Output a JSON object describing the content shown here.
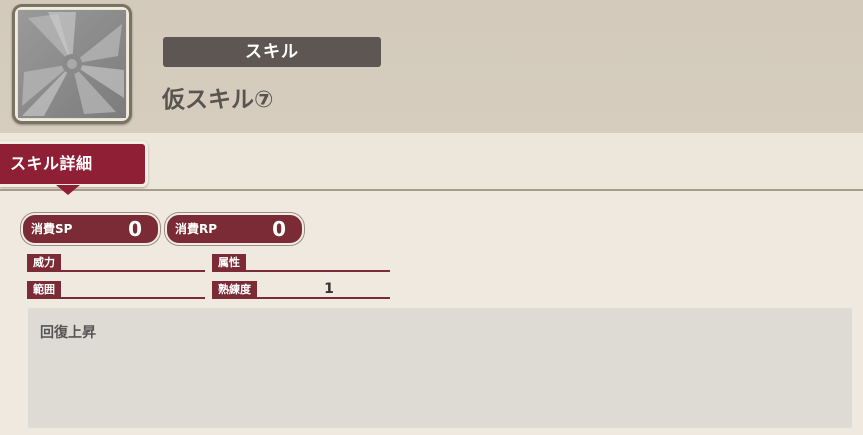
{
  "header": {
    "icon": "skill-placeholder-icon",
    "type_label": "スキル",
    "skill_name": "仮スキル⑦"
  },
  "tabs": [
    {
      "label": "スキル詳細",
      "active": true
    }
  ],
  "costs": {
    "sp": {
      "label": "消費SP",
      "value": "0"
    },
    "rp": {
      "label": "消費RP",
      "value": "0"
    }
  },
  "stats": {
    "power": {
      "label": "威力",
      "value": ""
    },
    "attribute": {
      "label": "属性",
      "value": ""
    },
    "range": {
      "label": "範囲",
      "value": ""
    },
    "proficiency": {
      "label": "熟練度",
      "value": "1"
    }
  },
  "description": "回復上昇",
  "colors": {
    "accent": "#8e1f34",
    "label_bg": "#7a2b35",
    "badge_bg": "#5e5652",
    "header_bg": "#d3cabc",
    "page_bg": "#efe9e0"
  }
}
